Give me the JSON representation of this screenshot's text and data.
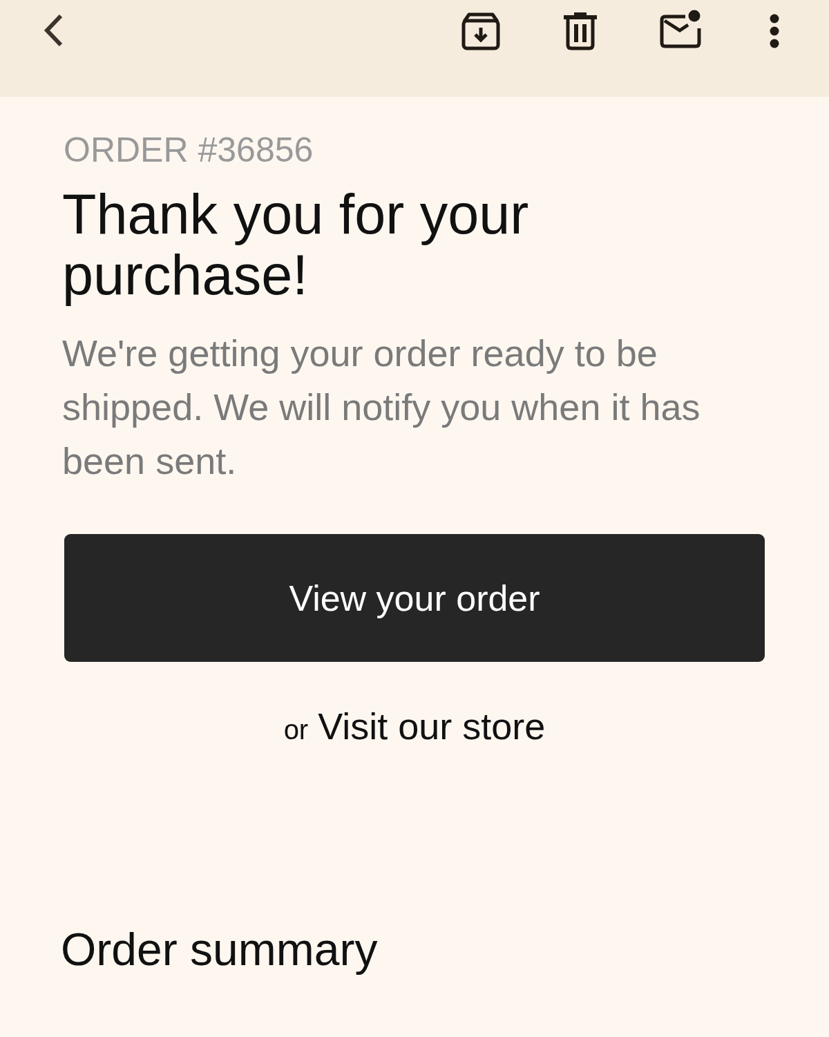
{
  "order_number": "ORDER #36856",
  "heading": "Thank you for your purchase!",
  "message": "We're getting your order ready to be shipped. We will notify you when it has been sent.",
  "primary_button": "View your order",
  "secondary_link": {
    "prefix": "or",
    "link": "Visit our store"
  },
  "summary_heading": "Order summary"
}
